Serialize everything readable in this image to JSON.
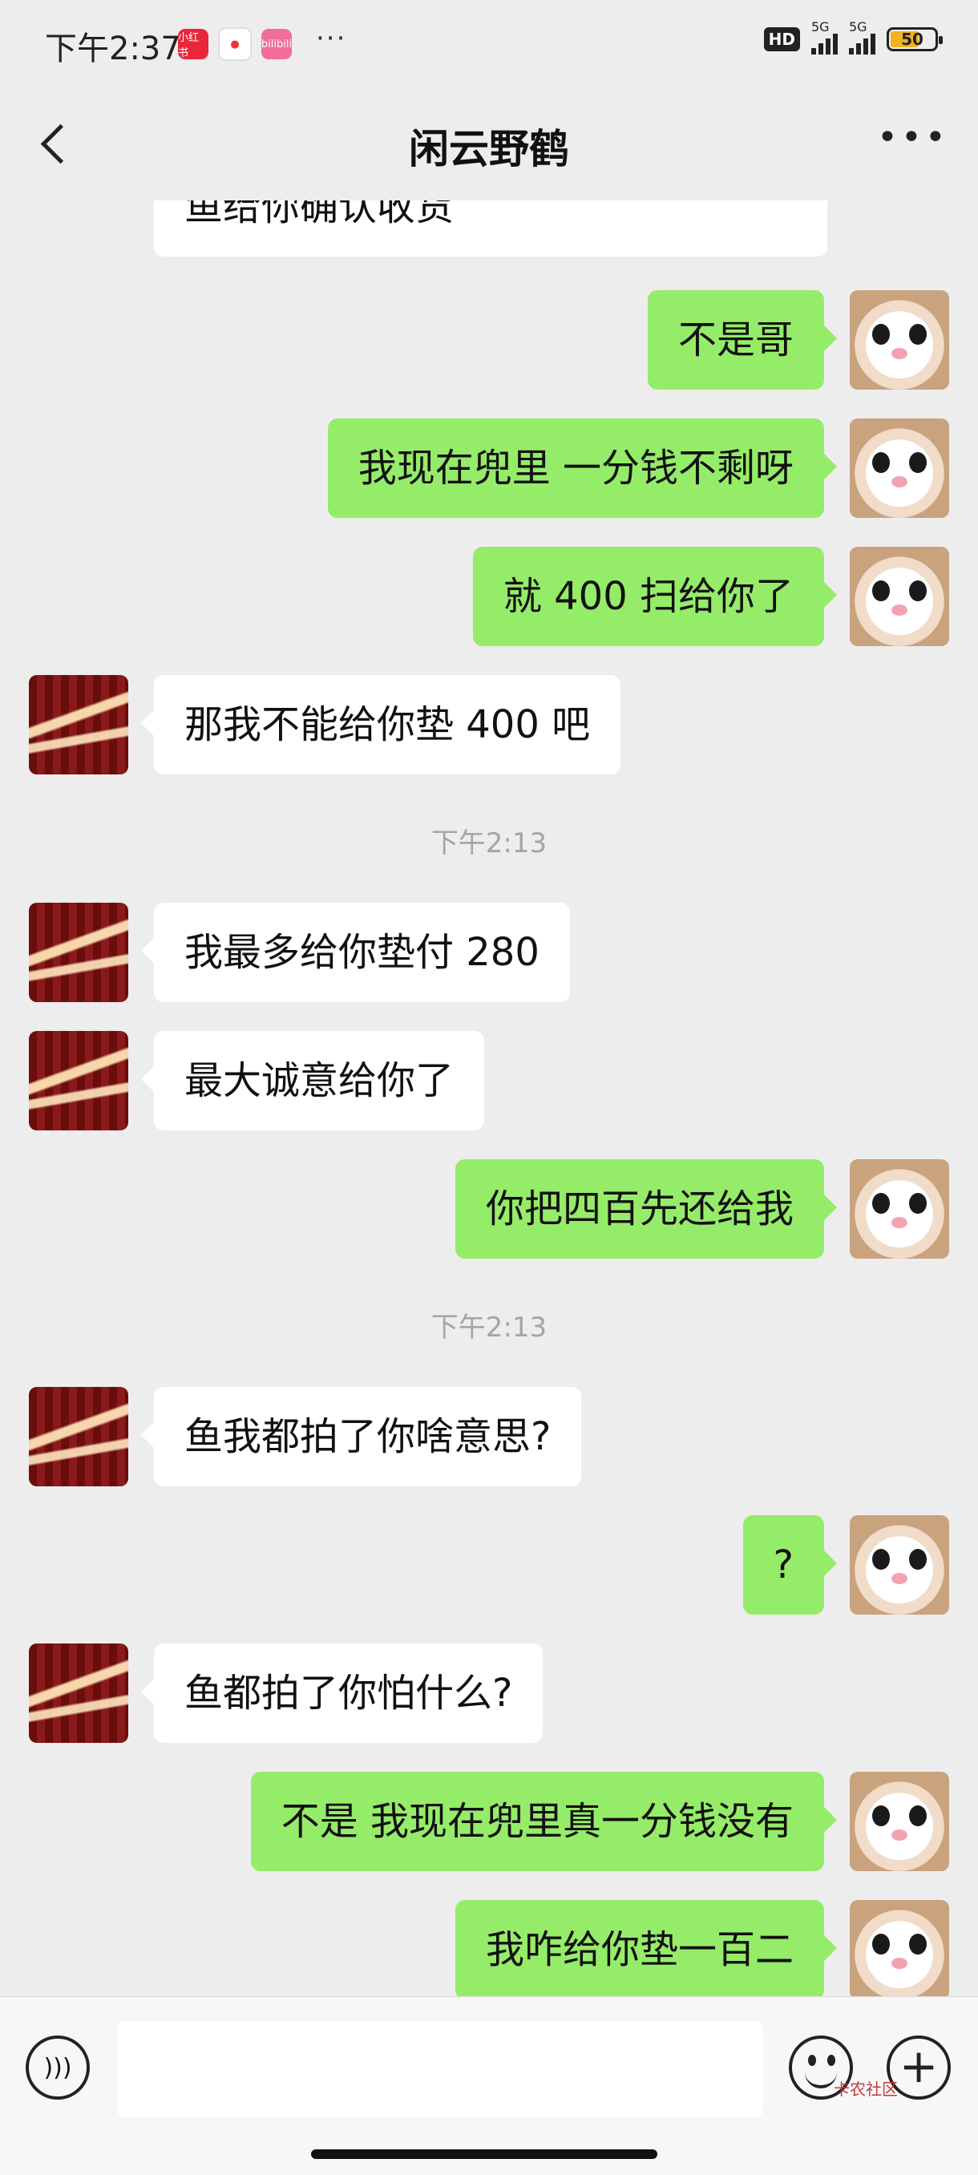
{
  "status_bar": {
    "time": "下午2:37",
    "apps": [
      "小红书",
      "地图",
      "bilibili"
    ],
    "overflow": "···",
    "hd_label": "HD",
    "network_labels": [
      "5G",
      "5G"
    ],
    "battery": "50",
    "battery_color": "#f1b21f"
  },
  "nav": {
    "title": "闲云野鹤",
    "more_icon": "more-dots-icon"
  },
  "messages": [
    {
      "side": "in",
      "text": "鱼给你确认收货",
      "partial": true
    },
    {
      "side": "out",
      "text": "不是哥"
    },
    {
      "side": "out",
      "text": "我现在兜里 一分钱不剩呀"
    },
    {
      "side": "out",
      "text": "就 400 扫给你了"
    },
    {
      "side": "in",
      "text": "那我不能给你垫 400 吧"
    },
    {
      "type": "time",
      "text": "下午2:13"
    },
    {
      "side": "in",
      "text": "我最多给你垫付 280"
    },
    {
      "side": "in",
      "text": "最大诚意给你了"
    },
    {
      "side": "out",
      "text": "你把四百先还给我"
    },
    {
      "type": "time",
      "text": "下午2:13"
    },
    {
      "side": "in",
      "text": "鱼我都拍了你啥意思?"
    },
    {
      "side": "out",
      "text": "?"
    },
    {
      "side": "in",
      "text": "鱼都拍了你怕什么?"
    },
    {
      "side": "out",
      "text": "不是 我现在兜里真一分钱没有"
    },
    {
      "side": "out",
      "text": "我咋给你垫一百二"
    }
  ],
  "input_bar": {
    "voice_icon": "voice-icon",
    "emoji_icon": "emoji-icon",
    "plus_icon": "plus-icon",
    "value": ""
  },
  "watermark": "卡农社区",
  "colors": {
    "outgoing_bubble": "#95ec69",
    "incoming_bubble": "#ffffff",
    "background": "#ededed"
  }
}
